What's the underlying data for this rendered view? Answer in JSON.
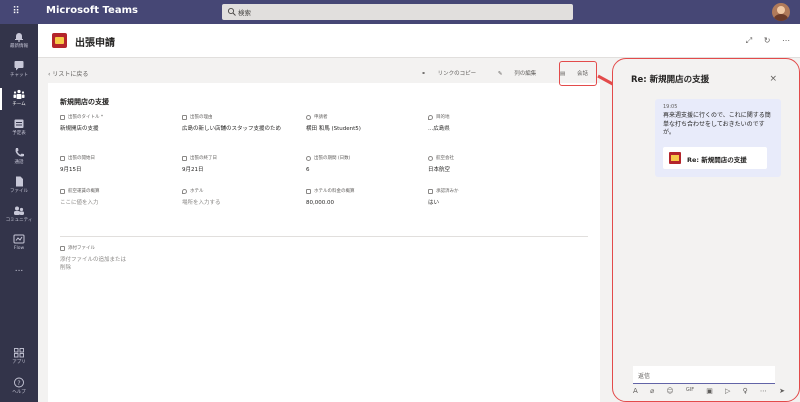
{
  "app": {
    "title": "Microsoft Teams"
  },
  "search": {
    "placeholder": "検索"
  },
  "rail": {
    "items": [
      {
        "label": "最新情報"
      },
      {
        "label": "チャット"
      },
      {
        "label": "チーム"
      },
      {
        "label": "予定表"
      },
      {
        "label": "通話"
      },
      {
        "label": "ファイル"
      },
      {
        "label": "コミュニティ"
      },
      {
        "label": "Flow"
      },
      {
        "label": "..."
      },
      {
        "label": "アプリ"
      },
      {
        "label": "ヘルプ"
      }
    ]
  },
  "header": {
    "title": "出張申請"
  },
  "main": {
    "back_label": "リストに戻る",
    "copy_link": "リンクのコピー",
    "edit_columns": "列の編集",
    "conversation": "会話"
  },
  "record": {
    "title": "新規開店の支援",
    "fields": [
      {
        "label": "出張のタイトル *",
        "value": "新規開店の支援",
        "placeholder": false
      },
      {
        "label": "出張の理由",
        "value": "広島の新しい店舗のスタッフ支援のため",
        "placeholder": false
      },
      {
        "label": "申請者",
        "value": "横田 和馬 (Student5)",
        "placeholder": false
      },
      {
        "label": "目的地",
        "value": "...広島県",
        "placeholder": false
      },
      {
        "label": "出張の開始日",
        "value": "9月15日",
        "placeholder": false
      },
      {
        "label": "出張の終了日",
        "value": "9月21日",
        "placeholder": false
      },
      {
        "label": "出張の期間 (日数)",
        "value": "6",
        "placeholder": false
      },
      {
        "label": "航空会社",
        "value": "日本航空",
        "placeholder": false
      },
      {
        "label": "航空運賃の概算",
        "value": "ここに値を入力",
        "placeholder": true
      },
      {
        "label": "ホテル",
        "value": "場所を入力する",
        "placeholder": true
      },
      {
        "label": "ホテルの料金の概算",
        "value": "80,000.00",
        "placeholder": false
      },
      {
        "label": "承認済みか",
        "value": "はい",
        "placeholder": false
      }
    ],
    "attachment": {
      "label": "添付ファイル",
      "placeholder": "添付ファイルの追加または削除"
    }
  },
  "panel": {
    "title": "Re: 新規開店の支援",
    "close": "×",
    "message": {
      "time": "19:05",
      "text": "再来週支援に行くので、これに関する簡単な打ち合わせをしておきたいのですが。",
      "card_title": "Re: 新規開店の支援"
    },
    "reply_placeholder": "返信",
    "tools": [
      "A",
      "⌀",
      "☺",
      "GIF",
      "▣",
      "▷",
      "♀",
      "⋯",
      "➤"
    ]
  },
  "colors": {
    "topbar": "#464775",
    "rail": "#33344a",
    "accent": "#6264a7",
    "highlight": "#e34b4b"
  }
}
